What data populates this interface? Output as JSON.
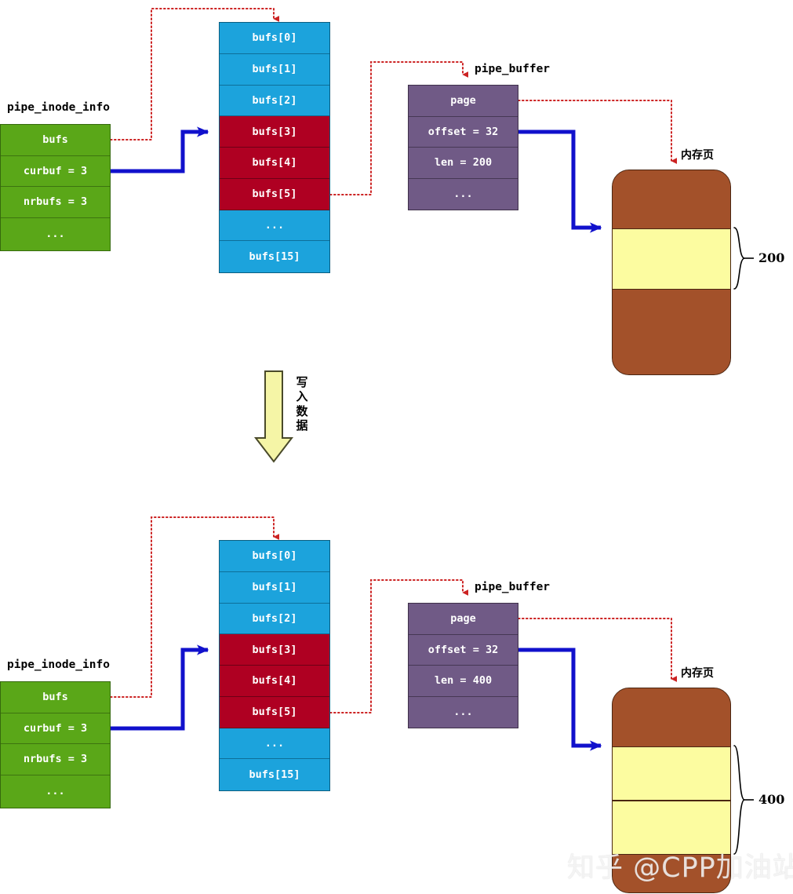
{
  "diagram": {
    "title_top": "pipe_inode_info",
    "watermark": "知乎 @CPP加油站",
    "middle_arrow_label": "写入数据",
    "colors": {
      "green": "#5AA718",
      "cyan": "#1CA3DC",
      "dark_red": "#AF0022",
      "purple": "#705A86",
      "brown": "#A3512A",
      "yellow": "#FCFCA0",
      "blue_arrow": "#1111CC",
      "red_dotted": "#CC2222"
    }
  },
  "top": {
    "pipe_inode_info": {
      "label": "pipe_inode_info",
      "rows": [
        {
          "text": "bufs"
        },
        {
          "text": "curbuf = 3"
        },
        {
          "text": "nrbufs = 3"
        },
        {
          "text": "..."
        }
      ]
    },
    "bufs_array": {
      "rows": [
        {
          "text": "bufs[0]",
          "state": "free"
        },
        {
          "text": "bufs[1]",
          "state": "free"
        },
        {
          "text": "bufs[2]",
          "state": "free"
        },
        {
          "text": "bufs[3]",
          "state": "used"
        },
        {
          "text": "bufs[4]",
          "state": "used"
        },
        {
          "text": "bufs[5]",
          "state": "used"
        },
        {
          "text": "...",
          "state": "free"
        },
        {
          "text": "bufs[15]",
          "state": "free"
        }
      ]
    },
    "pipe_buffer": {
      "label": "pipe_buffer",
      "rows": [
        {
          "text": "page"
        },
        {
          "text": "offset = 32"
        },
        {
          "text": "len = 200"
        },
        {
          "text": "..."
        }
      ]
    },
    "memory_page": {
      "label": "内存页",
      "size_label": "200",
      "segments": [
        {
          "kind": "brown",
          "height": 64
        },
        {
          "kind": "yellow",
          "height": 78
        },
        {
          "kind": "brown",
          "height": 134
        }
      ]
    }
  },
  "bottom": {
    "pipe_inode_info": {
      "label": "pipe_inode_info",
      "rows": [
        {
          "text": "bufs"
        },
        {
          "text": "curbuf = 3"
        },
        {
          "text": "nrbufs = 3"
        },
        {
          "text": "..."
        }
      ]
    },
    "bufs_array": {
      "rows": [
        {
          "text": "bufs[0]",
          "state": "free"
        },
        {
          "text": "bufs[1]",
          "state": "free"
        },
        {
          "text": "bufs[2]",
          "state": "free"
        },
        {
          "text": "bufs[3]",
          "state": "used"
        },
        {
          "text": "bufs[4]",
          "state": "used"
        },
        {
          "text": "bufs[5]",
          "state": "used"
        },
        {
          "text": "...",
          "state": "free"
        },
        {
          "text": "bufs[15]",
          "state": "free"
        }
      ]
    },
    "pipe_buffer": {
      "label": "pipe_buffer",
      "rows": [
        {
          "text": "page"
        },
        {
          "text": "offset = 32"
        },
        {
          "text": "len = 400"
        },
        {
          "text": "..."
        }
      ]
    },
    "memory_page": {
      "label": "内存页",
      "size_label": "400",
      "segments": [
        {
          "kind": "brown",
          "height": 64
        },
        {
          "kind": "yellow",
          "height": 72
        },
        {
          "kind": "yellow",
          "height": 72
        },
        {
          "kind": "brown",
          "height": 60
        }
      ]
    }
  }
}
